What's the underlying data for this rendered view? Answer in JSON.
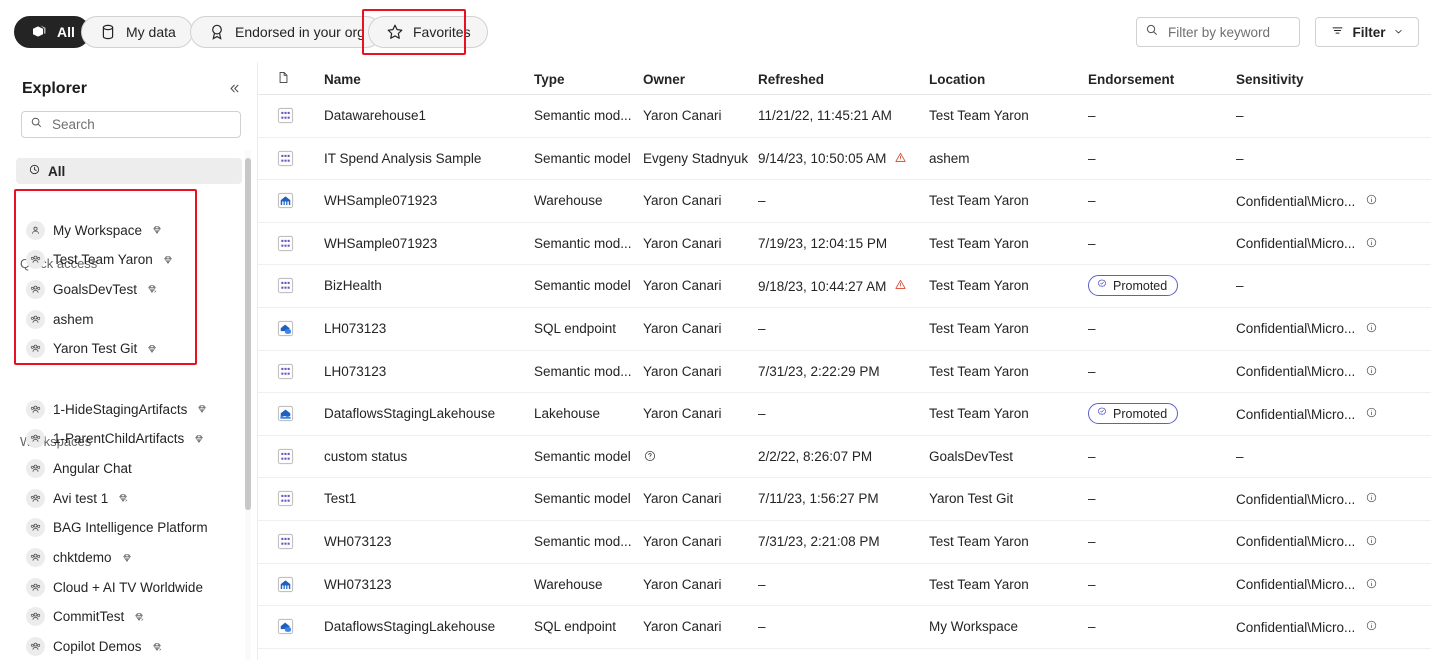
{
  "topbar": {
    "pills": [
      {
        "label": "All",
        "icon": "cube-stack-icon",
        "active": true
      },
      {
        "label": "My data",
        "icon": "database-icon",
        "active": false
      },
      {
        "label": "Endorsed in your org",
        "icon": "endorsement-badge-icon",
        "active": false
      },
      {
        "label": "Favorites",
        "icon": "star-icon",
        "active": false,
        "highlighted": true
      }
    ],
    "search_placeholder": "Filter by keyword",
    "search_value": "",
    "filter_label": "Filter",
    "highlight_color": "#e81123"
  },
  "sidebar": {
    "title": "Explorer",
    "collapse_icon": "chevron-double-left-icon",
    "search_placeholder": "Search",
    "search_value": "",
    "nav_all": {
      "label": "All",
      "icon": "recent-clock-icon"
    },
    "quick_access_label": "Quick access",
    "quick_access": [
      {
        "label": "My Workspace",
        "avatar": "person-icon",
        "capacity": "premium-gem-icon"
      },
      {
        "label": "Test Team Yaron",
        "avatar": "people-icon",
        "capacity": "premium-gem-icon"
      },
      {
        "label": "GoalsDevTest",
        "avatar": "people-icon",
        "capacity": "premium-per-user-gem-icon"
      },
      {
        "label": "ashem",
        "avatar": "people-icon",
        "capacity": null
      },
      {
        "label": "Yaron Test Git",
        "avatar": "people-icon",
        "capacity": "premium-gem-icon"
      }
    ],
    "workspaces_label": "Workspaces",
    "workspaces": [
      {
        "label": "1-HideStagingArtifacts",
        "avatar": "people-icon",
        "capacity": "premium-gem-icon"
      },
      {
        "label": "1-ParentChildArtifacts",
        "avatar": "people-icon",
        "capacity": "premium-gem-icon"
      },
      {
        "label": "Angular Chat",
        "avatar": "people-icon",
        "capacity": null
      },
      {
        "label": "Avi test 1",
        "avatar": "people-icon",
        "capacity": "premium-per-user-gem-icon"
      },
      {
        "label": "BAG Intelligence Platform",
        "avatar": "people-icon",
        "capacity": null
      },
      {
        "label": "chktdemo",
        "avatar": "people-icon",
        "capacity": "premium-gem-icon"
      },
      {
        "label": "Cloud + AI TV Worldwide",
        "avatar": "people-icon",
        "capacity": null
      },
      {
        "label": "CommitTest",
        "avatar": "people-icon",
        "capacity": "premium-per-user-gem-icon"
      },
      {
        "label": "Copilot Demos",
        "avatar": "people-icon",
        "capacity": "premium-per-user-gem-icon"
      }
    ]
  },
  "table": {
    "columns": [
      {
        "key": "icon",
        "label": "",
        "icon": "document-icon"
      },
      {
        "key": "name",
        "label": "Name"
      },
      {
        "key": "type",
        "label": "Type"
      },
      {
        "key": "owner",
        "label": "Owner"
      },
      {
        "key": "refreshed",
        "label": "Refreshed"
      },
      {
        "key": "location",
        "label": "Location"
      },
      {
        "key": "endorsement",
        "label": "Endorsement"
      },
      {
        "key": "sensitivity",
        "label": "Sensitivity"
      }
    ],
    "rows": [
      {
        "icon": "semantic-model-icon",
        "name": "Datawarehouse1",
        "type": "Semantic mod...",
        "owner": "Yaron Canari",
        "owner_icon": null,
        "refreshed": "11/21/22, 11:45:21 AM",
        "refresh_warning": false,
        "location": "Test Team Yaron",
        "endorsement": "–",
        "sensitivity": "–",
        "sensitivity_info": false
      },
      {
        "icon": "semantic-model-icon",
        "name": "IT Spend Analysis Sample",
        "type": "Semantic model",
        "owner": "Evgeny Stadnyuk",
        "owner_icon": null,
        "refreshed": "9/14/23, 10:50:05 AM",
        "refresh_warning": true,
        "location": "ashem",
        "endorsement": "–",
        "sensitivity": "–",
        "sensitivity_info": false
      },
      {
        "icon": "warehouse-icon",
        "name": "WHSample071923",
        "type": "Warehouse",
        "owner": "Yaron Canari",
        "owner_icon": null,
        "refreshed": "–",
        "refresh_warning": false,
        "location": "Test Team Yaron",
        "endorsement": "–",
        "sensitivity": "Confidential\\Micro...",
        "sensitivity_info": true
      },
      {
        "icon": "semantic-model-icon",
        "name": "WHSample071923",
        "type": "Semantic mod...",
        "owner": "Yaron Canari",
        "owner_icon": null,
        "refreshed": "7/19/23, 12:04:15 PM",
        "refresh_warning": false,
        "location": "Test Team Yaron",
        "endorsement": "–",
        "sensitivity": "Confidential\\Micro...",
        "sensitivity_info": true
      },
      {
        "icon": "semantic-model-icon",
        "name": "BizHealth",
        "type": "Semantic model",
        "owner": "Yaron Canari",
        "owner_icon": null,
        "refreshed": "9/18/23, 10:44:27 AM",
        "refresh_warning": true,
        "location": "Test Team Yaron",
        "endorsement": "Promoted",
        "sensitivity": "–",
        "sensitivity_info": false
      },
      {
        "icon": "sql-endpoint-icon",
        "name": "LH073123",
        "type": "SQL endpoint",
        "owner": "Yaron Canari",
        "owner_icon": null,
        "refreshed": "–",
        "refresh_warning": false,
        "location": "Test Team Yaron",
        "endorsement": "–",
        "sensitivity": "Confidential\\Micro...",
        "sensitivity_info": true
      },
      {
        "icon": "semantic-model-icon",
        "name": "LH073123",
        "type": "Semantic mod...",
        "owner": "Yaron Canari",
        "owner_icon": null,
        "refreshed": "7/31/23, 2:22:29 PM",
        "refresh_warning": false,
        "location": "Test Team Yaron",
        "endorsement": "–",
        "sensitivity": "Confidential\\Micro...",
        "sensitivity_info": true
      },
      {
        "icon": "lakehouse-icon",
        "name": "DataflowsStagingLakehouse",
        "type": "Lakehouse",
        "owner": "Yaron Canari",
        "owner_icon": null,
        "refreshed": "–",
        "refresh_warning": false,
        "location": "Test Team Yaron",
        "endorsement": "Promoted",
        "sensitivity": "Confidential\\Micro...",
        "sensitivity_info": true
      },
      {
        "icon": "semantic-model-icon",
        "name": "custom status",
        "type": "Semantic model",
        "owner": "",
        "owner_icon": "unknown-owner-icon",
        "refreshed": "2/2/22, 8:26:07 PM",
        "refresh_warning": false,
        "location": "GoalsDevTest",
        "endorsement": "–",
        "sensitivity": "–",
        "sensitivity_info": false
      },
      {
        "icon": "semantic-model-icon",
        "name": "Test1",
        "type": "Semantic model",
        "owner": "Yaron Canari",
        "owner_icon": null,
        "refreshed": "7/11/23, 1:56:27 PM",
        "refresh_warning": false,
        "location": "Yaron Test Git",
        "endorsement": "–",
        "sensitivity": "Confidential\\Micro...",
        "sensitivity_info": true
      },
      {
        "icon": "semantic-model-icon",
        "name": "WH073123",
        "type": "Semantic mod...",
        "owner": "Yaron Canari",
        "owner_icon": null,
        "refreshed": "7/31/23, 2:21:08 PM",
        "refresh_warning": false,
        "location": "Test Team Yaron",
        "endorsement": "–",
        "sensitivity": "Confidential\\Micro...",
        "sensitivity_info": true
      },
      {
        "icon": "warehouse-icon",
        "name": "WH073123",
        "type": "Warehouse",
        "owner": "Yaron Canari",
        "owner_icon": null,
        "refreshed": "–",
        "refresh_warning": false,
        "location": "Test Team Yaron",
        "endorsement": "–",
        "sensitivity": "Confidential\\Micro...",
        "sensitivity_info": true
      },
      {
        "icon": "sql-endpoint-icon",
        "name": "DataflowsStagingLakehouse",
        "type": "SQL endpoint",
        "owner": "Yaron Canari",
        "owner_icon": null,
        "refreshed": "–",
        "refresh_warning": false,
        "location": "My Workspace",
        "endorsement": "–",
        "sensitivity": "Confidential\\Micro...",
        "sensitivity_info": true
      }
    ]
  }
}
